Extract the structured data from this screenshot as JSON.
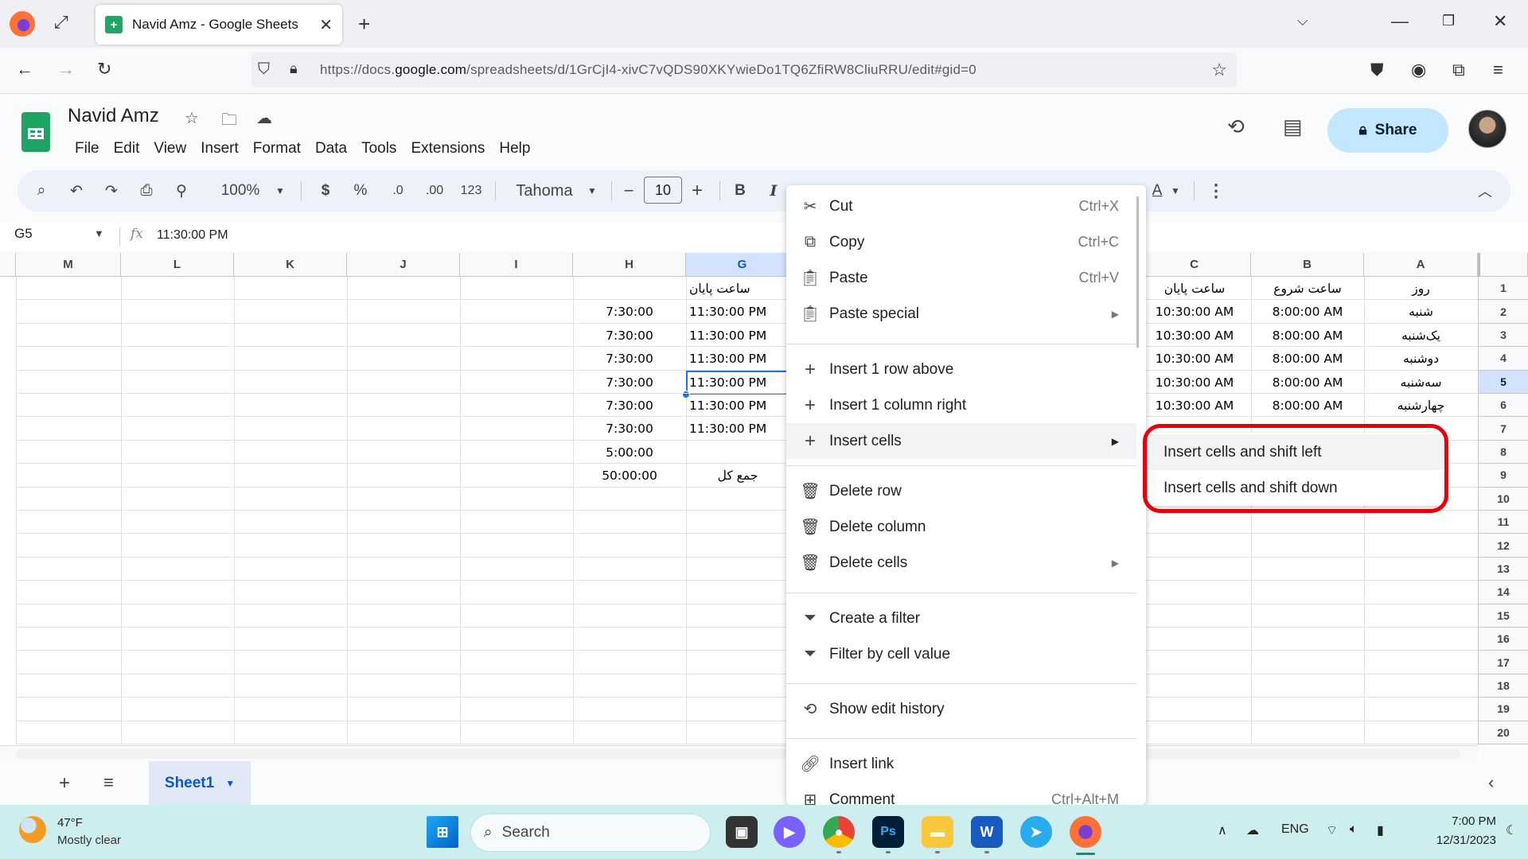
{
  "browser": {
    "tab_title": "Navid Amz - Google Sheets",
    "url_prefix": "https://docs.",
    "url_domain": "google.com",
    "url_rest": "/spreadsheets/d/1GrCjI4-xivC7vQDS90XKYwieDo1TQ6ZfiRW8CliuRRU/edit#gid=0"
  },
  "sheets": {
    "doc_title": "Navid Amz",
    "menu": [
      "File",
      "Edit",
      "View",
      "Insert",
      "Format",
      "Data",
      "Tools",
      "Extensions",
      "Help"
    ],
    "share_label": "Share",
    "toolbar": {
      "zoom": "100%",
      "currency": "$",
      "percent": "%",
      "decrease_decimal": ".0",
      "increase_decimal": ".00",
      "number_format": "123",
      "font": "Tahoma",
      "font_size": "10",
      "bold": "B",
      "italic": "I",
      "text_color": "A"
    },
    "formula_bar": {
      "cell_ref": "G5",
      "fx": "fx",
      "value": "11:30:00 PM"
    },
    "column_headers": {
      "M": "M",
      "L": "L",
      "K": "K",
      "J": "J",
      "I": "I",
      "H": "H",
      "G": "G",
      "C": "C",
      "B": "B",
      "A": "A"
    },
    "row_numbers": [
      "1",
      "2",
      "3",
      "4",
      "5",
      "6",
      "7",
      "8",
      "9",
      "10",
      "11",
      "12",
      "13",
      "14",
      "15",
      "16",
      "17",
      "18",
      "19",
      "20"
    ],
    "selected_cell": "G5",
    "cells": {
      "A": [
        "روز",
        "شنبه",
        "یک‌شنبه",
        "دوشنبه",
        "سه‌شنبه",
        "چهارشنبه"
      ],
      "B": [
        "ساعت شروع",
        "8:00:00 AM",
        "8:00:00 AM",
        "8:00:00 AM",
        "8:00:00 AM",
        "8:00:00 AM"
      ],
      "C": [
        "ساعت پایان",
        "10:30:00 AM",
        "10:30:00 AM",
        "10:30:00 AM",
        "10:30:00 AM",
        "10:30:00 AM"
      ],
      "G": [
        "ساعت پایان",
        "11:30:00 PM",
        "11:30:00 PM",
        "11:30:00 PM",
        "11:30:00 PM",
        "11:30:00 PM",
        "11:30:00 PM",
        "",
        "جمع کل"
      ],
      "H": [
        "",
        "7:30:00",
        "7:30:00",
        "7:30:00",
        "7:30:00",
        "7:30:00",
        "7:30:00",
        "5:00:00",
        "50:00:00"
      ]
    },
    "sheet_tab": "Sheet1"
  },
  "context_menu": {
    "items": [
      {
        "icon": "cut-icon",
        "label": "Cut",
        "shortcut": "Ctrl+X"
      },
      {
        "icon": "copy-icon",
        "label": "Copy",
        "shortcut": "Ctrl+C"
      },
      {
        "icon": "paste-icon",
        "label": "Paste",
        "shortcut": "Ctrl+V"
      },
      {
        "icon": "paste-icon",
        "label": "Paste special",
        "submenu": true
      },
      {
        "icon": "plus-icon",
        "label": "Insert 1 row above"
      },
      {
        "icon": "plus-icon",
        "label": "Insert 1 column right"
      },
      {
        "icon": "plus-icon",
        "label": "Insert cells",
        "submenu": true,
        "highlighted": true
      },
      {
        "icon": "trash-icon",
        "label": "Delete row"
      },
      {
        "icon": "trash-icon",
        "label": "Delete column"
      },
      {
        "icon": "trash-icon",
        "label": "Delete cells",
        "submenu": true
      },
      {
        "icon": "filter-icon",
        "label": "Create a filter"
      },
      {
        "icon": "filter-icon",
        "label": "Filter by cell value"
      },
      {
        "icon": "history-icon",
        "label": "Show edit history"
      },
      {
        "icon": "link-icon",
        "label": "Insert link"
      },
      {
        "icon": "comment-icon",
        "label": "Comment",
        "shortcut": "Ctrl+Alt+M"
      }
    ],
    "submenu": {
      "items": [
        "Insert cells and shift left",
        "Insert cells and shift down"
      ],
      "highlighted_index": 0
    },
    "annotation_color": "#e8000b"
  },
  "taskbar": {
    "weather_temp": "47°F",
    "weather_desc": "Mostly clear",
    "search_label": "Search",
    "language": "ENG",
    "time": "7:00 PM",
    "date": "12/31/2023"
  },
  "colors": {
    "accent": "#1a73e8",
    "share_bg": "#c2e7ff",
    "sheets_green": "#1ea362"
  }
}
